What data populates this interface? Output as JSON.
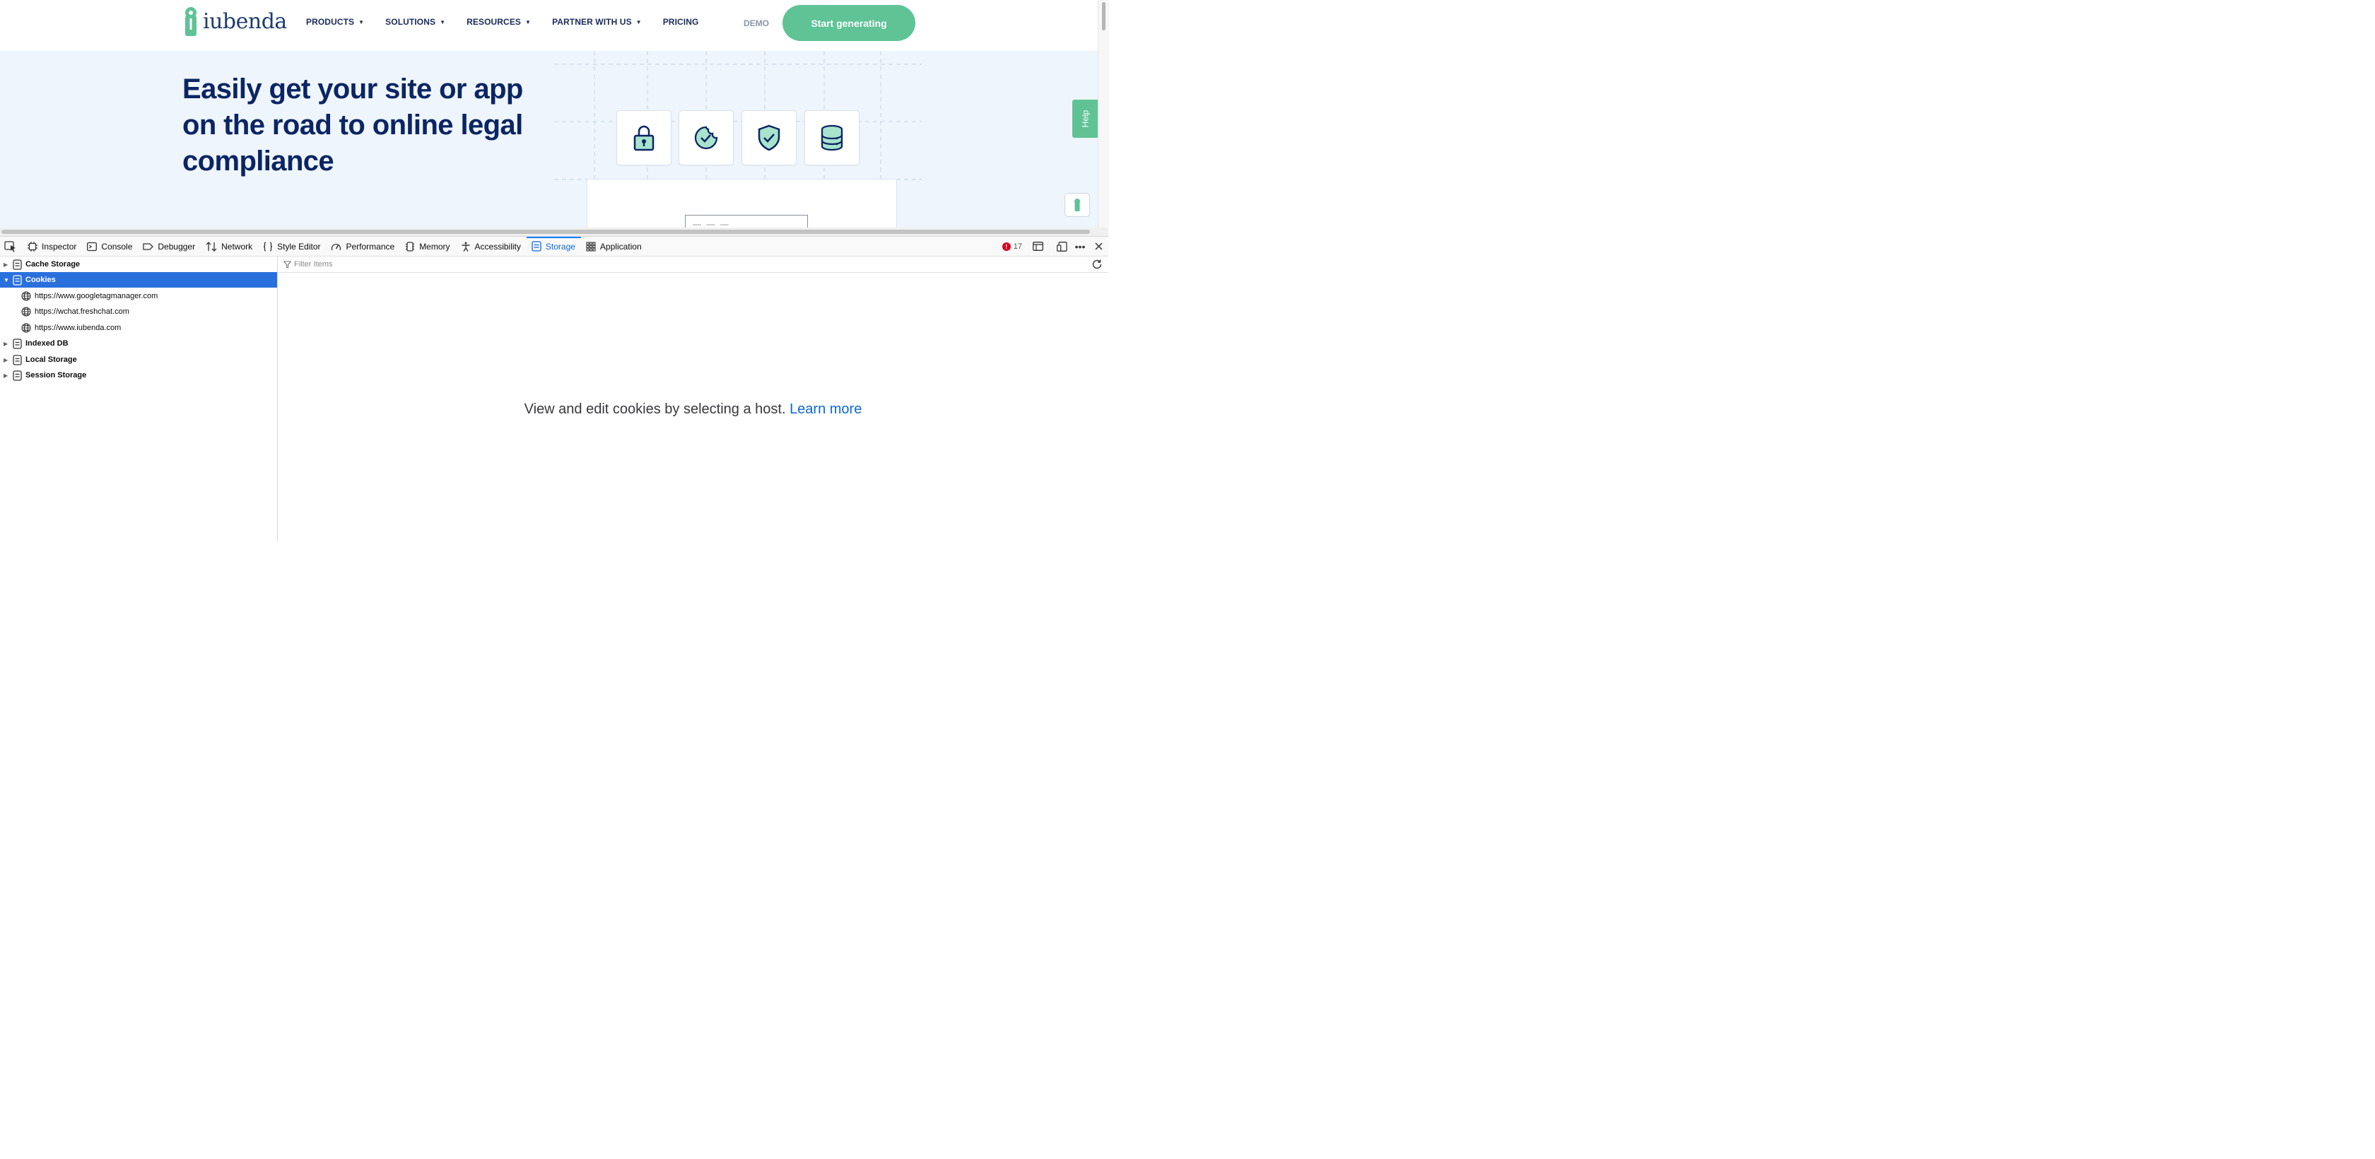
{
  "website": {
    "logo_text": "iubenda",
    "nav": [
      {
        "label": "PRODUCTS",
        "has_dropdown": true
      },
      {
        "label": "SOLUTIONS",
        "has_dropdown": true
      },
      {
        "label": "RESOURCES",
        "has_dropdown": true
      },
      {
        "label": "PARTNER WITH US",
        "has_dropdown": true
      },
      {
        "label": "PRICING",
        "has_dropdown": false
      }
    ],
    "demo_label": "DEMO",
    "cta_label": "Start generating",
    "hero_title": "Easily get your site or app on the road to online legal compliance",
    "feature_icons": [
      "lock-icon",
      "cookie-check-icon",
      "shield-check-icon",
      "database-icon"
    ],
    "preview_dash": "— — —",
    "help_label": "Help",
    "colors": {
      "brand_green": "#5fc396",
      "navy": "#0b2564",
      "hero_bg": "#eef5fc"
    }
  },
  "devtools": {
    "tabs": [
      {
        "label": "Inspector",
        "icon": "inspector-icon",
        "selected": false
      },
      {
        "label": "Console",
        "icon": "console-icon",
        "selected": false
      },
      {
        "label": "Debugger",
        "icon": "debugger-icon",
        "selected": false
      },
      {
        "label": "Network",
        "icon": "network-icon",
        "selected": false
      },
      {
        "label": "Style Editor",
        "icon": "style-editor-icon",
        "selected": false
      },
      {
        "label": "Performance",
        "icon": "performance-icon",
        "selected": false
      },
      {
        "label": "Memory",
        "icon": "memory-icon",
        "selected": false
      },
      {
        "label": "Accessibility",
        "icon": "accessibility-icon",
        "selected": false
      },
      {
        "label": "Storage",
        "icon": "storage-icon",
        "selected": true
      },
      {
        "label": "Application",
        "icon": "application-icon",
        "selected": false
      }
    ],
    "error_count": "17",
    "colors": {
      "selected_row": "#2a70dd",
      "selected_tab": "#0a68d8",
      "error": "#d70022"
    },
    "tree": {
      "cache_storage": "Cache Storage",
      "cookies": "Cookies",
      "hosts": [
        "https://www.googletagmanager.com",
        "https://wchat.freshchat.com",
        "https://www.iubenda.com"
      ],
      "indexed_db": "Indexed DB",
      "local_storage": "Local Storage",
      "session_storage": "Session Storage"
    },
    "filter_placeholder": "Filter Items",
    "empty_message": "View and edit cookies by selecting a host.",
    "learn_more": "Learn more"
  }
}
